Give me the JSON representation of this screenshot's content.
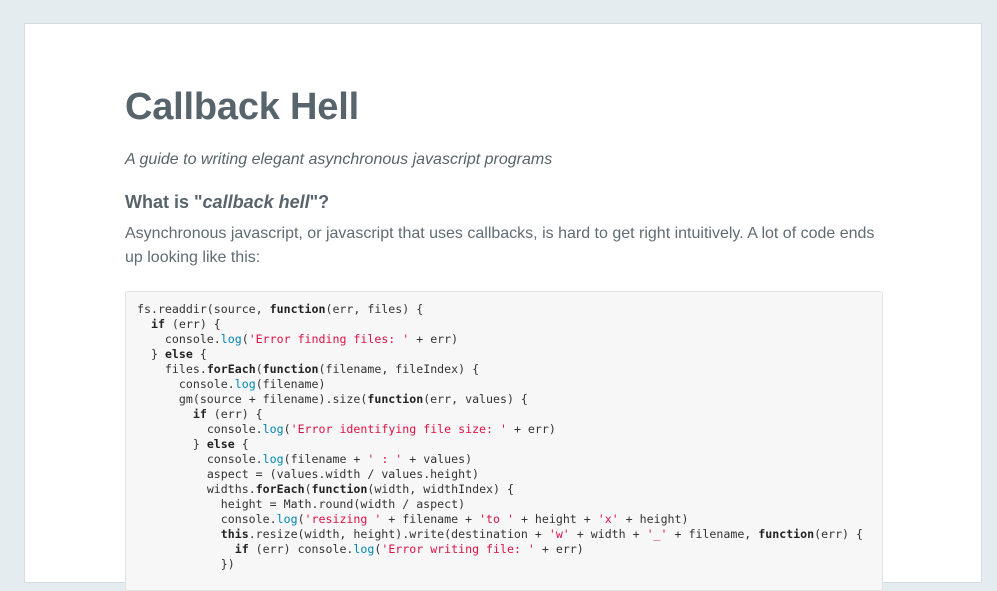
{
  "page": {
    "title": "Callback Hell",
    "subtitle": "A guide to writing elegant asynchronous javascript programs",
    "section_heading": {
      "prefix": "What is \"",
      "emphasis": "callback hell",
      "suffix": "\"?"
    },
    "intro": "Asynchronous javascript, or javascript that uses callbacks, is hard to get right intuitively. A lot of code ends up looking like this:"
  },
  "code_lines": [
    {
      "indent": 0,
      "tokens": [
        [
          "",
          "fs.readdir(source, "
        ],
        [
          "k",
          "function"
        ],
        [
          "",
          "(err, files) {"
        ]
      ]
    },
    {
      "indent": 1,
      "tokens": [
        [
          "k",
          "if"
        ],
        [
          "",
          " (err) {"
        ]
      ]
    },
    {
      "indent": 2,
      "tokens": [
        [
          "",
          "console."
        ],
        [
          "f",
          "log"
        ],
        [
          "",
          "("
        ],
        [
          "s",
          "'Error finding files: '"
        ],
        [
          "",
          " + err)"
        ]
      ]
    },
    {
      "indent": 1,
      "tokens": [
        [
          "",
          "} "
        ],
        [
          "k",
          "else"
        ],
        [
          "",
          " {"
        ]
      ]
    },
    {
      "indent": 2,
      "tokens": [
        [
          "",
          "files."
        ],
        [
          "k",
          "forEach"
        ],
        [
          "",
          "("
        ],
        [
          "k",
          "function"
        ],
        [
          "",
          "(filename, fileIndex) {"
        ]
      ]
    },
    {
      "indent": 3,
      "tokens": [
        [
          "",
          "console."
        ],
        [
          "f",
          "log"
        ],
        [
          "",
          "(filename)"
        ]
      ]
    },
    {
      "indent": 3,
      "tokens": [
        [
          "",
          "gm(source + filename).size("
        ],
        [
          "k",
          "function"
        ],
        [
          "",
          "(err, values) {"
        ]
      ]
    },
    {
      "indent": 4,
      "tokens": [
        [
          "k",
          "if"
        ],
        [
          "",
          " (err) {"
        ]
      ]
    },
    {
      "indent": 5,
      "tokens": [
        [
          "",
          "console."
        ],
        [
          "f",
          "log"
        ],
        [
          "",
          "("
        ],
        [
          "s",
          "'Error identifying file size: '"
        ],
        [
          "",
          " + err)"
        ]
      ]
    },
    {
      "indent": 4,
      "tokens": [
        [
          "",
          "} "
        ],
        [
          "k",
          "else"
        ],
        [
          "",
          " {"
        ]
      ]
    },
    {
      "indent": 5,
      "tokens": [
        [
          "",
          "console."
        ],
        [
          "f",
          "log"
        ],
        [
          "",
          "(filename + "
        ],
        [
          "s",
          "' : '"
        ],
        [
          "",
          " + values)"
        ]
      ]
    },
    {
      "indent": 5,
      "tokens": [
        [
          "",
          "aspect = (values.width / values.height)"
        ]
      ]
    },
    {
      "indent": 5,
      "tokens": [
        [
          "",
          "widths."
        ],
        [
          "k",
          "forEach"
        ],
        [
          "",
          "("
        ],
        [
          "k",
          "function"
        ],
        [
          "",
          "(width, widthIndex) {"
        ]
      ]
    },
    {
      "indent": 6,
      "tokens": [
        [
          "",
          "height = Math.round(width / aspect)"
        ]
      ]
    },
    {
      "indent": 6,
      "tokens": [
        [
          "",
          "console."
        ],
        [
          "f",
          "log"
        ],
        [
          "",
          "("
        ],
        [
          "s",
          "'resizing '"
        ],
        [
          "",
          " + filename + "
        ],
        [
          "s",
          "'to '"
        ],
        [
          "",
          " + height + "
        ],
        [
          "s",
          "'x'"
        ],
        [
          "",
          " + height)"
        ]
      ]
    },
    {
      "indent": 6,
      "tokens": [
        [
          "k",
          "this"
        ],
        [
          "",
          ".resize(width, height).write(destination + "
        ],
        [
          "s",
          "'w'"
        ],
        [
          "",
          " + width + "
        ],
        [
          "s",
          "'_'"
        ],
        [
          "",
          " + filename, "
        ],
        [
          "k",
          "function"
        ],
        [
          "",
          "(err) {"
        ]
      ]
    },
    {
      "indent": 7,
      "tokens": [
        [
          "k",
          "if"
        ],
        [
          "",
          " (err) console."
        ],
        [
          "f",
          "log"
        ],
        [
          "",
          "("
        ],
        [
          "s",
          "'Error writing file: '"
        ],
        [
          "",
          " + err)"
        ]
      ]
    },
    {
      "indent": 6,
      "tokens": [
        [
          "",
          "})"
        ]
      ]
    }
  ],
  "colors": {
    "background": "#e4ecef",
    "heading": "#57646b",
    "keyword": "#222222",
    "string": "#dd1144",
    "builtin": "#0086b3"
  }
}
